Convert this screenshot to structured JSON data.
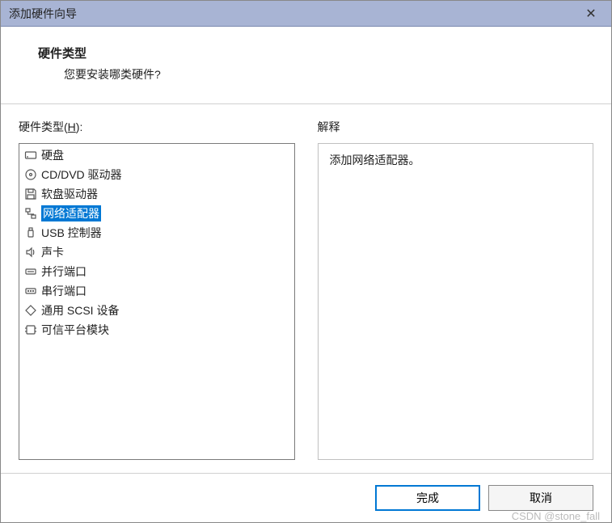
{
  "window": {
    "title": "添加硬件向导"
  },
  "header": {
    "title": "硬件类型",
    "subtitle": "您要安装哪类硬件?"
  },
  "leftPanel": {
    "label_pre": "硬件类型(",
    "label_key": "H",
    "label_post": "):"
  },
  "rightPanel": {
    "label": "解释",
    "description": "添加网络适配器。"
  },
  "hardwareList": [
    {
      "icon": "hard-disk",
      "label": "硬盘",
      "selected": false
    },
    {
      "icon": "cd-dvd",
      "label": "CD/DVD 驱动器",
      "selected": false
    },
    {
      "icon": "floppy",
      "label": "软盘驱动器",
      "selected": false
    },
    {
      "icon": "network",
      "label": "网络适配器",
      "selected": true
    },
    {
      "icon": "usb",
      "label": "USB 控制器",
      "selected": false
    },
    {
      "icon": "sound",
      "label": "声卡",
      "selected": false
    },
    {
      "icon": "parallel",
      "label": "并行端口",
      "selected": false
    },
    {
      "icon": "serial",
      "label": "串行端口",
      "selected": false
    },
    {
      "icon": "scsi",
      "label": "通用 SCSI 设备",
      "selected": false
    },
    {
      "icon": "tpm",
      "label": "可信平台模块",
      "selected": false
    }
  ],
  "footer": {
    "finish": "完成",
    "cancel": "取消"
  },
  "watermark": "CSDN @stone_fall"
}
